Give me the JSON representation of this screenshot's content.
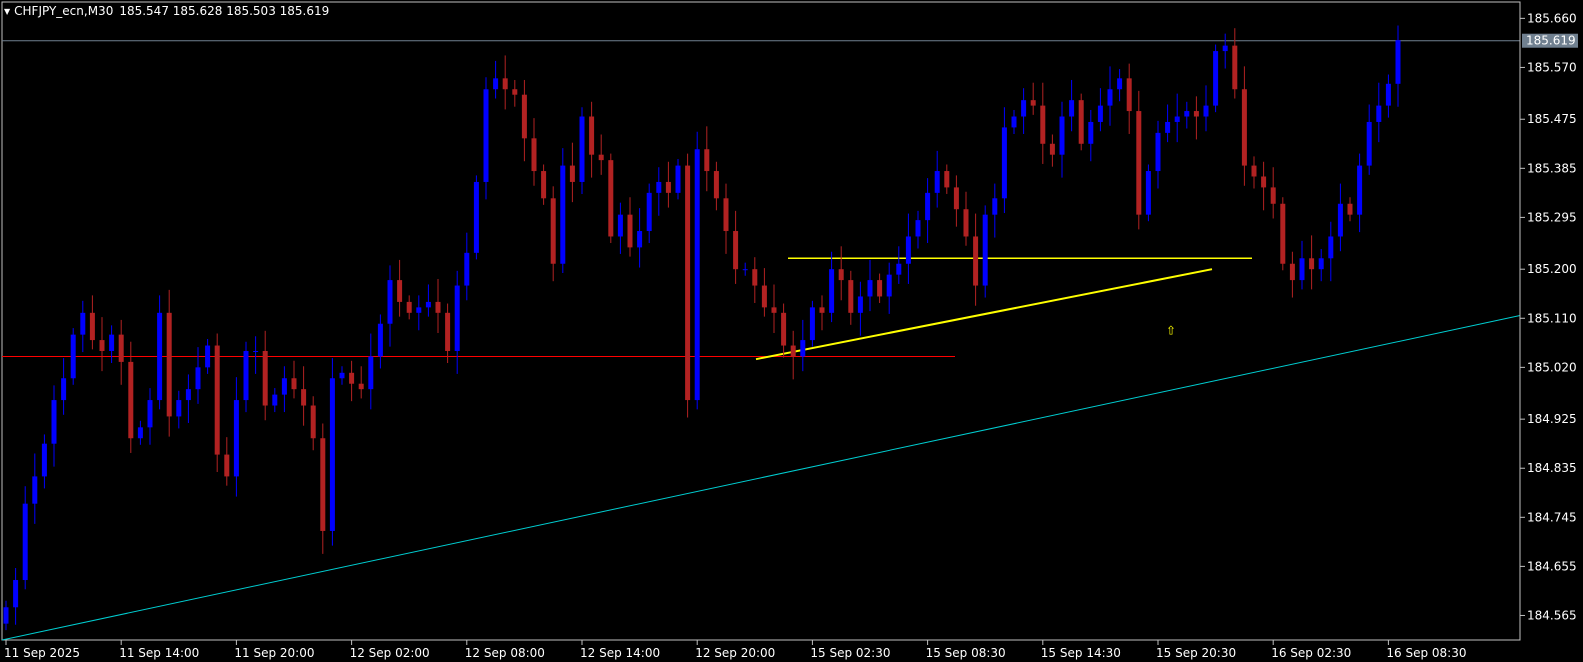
{
  "header": {
    "symbol": "CHFJPY_ecn,M30",
    "quotes": "185.547 185.628 185.503 185.619"
  },
  "colors": {
    "background": "#000000",
    "axis": "#c0c0c0",
    "bull": "#0000ff",
    "bear": "#b22222",
    "current_price_line": "#708090",
    "support_line": "#ff0000",
    "drawn_lines": "#ffff00",
    "trendline_long": "#00ced1",
    "arrow": "#ffff00"
  },
  "chart_data": {
    "type": "candlestick",
    "symbol": "CHFJPY_ecn",
    "timeframe": "M30",
    "ylim": [
      184.52,
      185.69
    ],
    "y_ticks": [
      "185.660",
      "185.570",
      "185.475",
      "185.385",
      "185.295",
      "185.200",
      "185.110",
      "185.020",
      "184.925",
      "184.835",
      "184.745",
      "184.655",
      "184.565"
    ],
    "x_ticks": [
      {
        "label": "11 Sep 2025",
        "bar": 0
      },
      {
        "label": "11 Sep 14:00",
        "bar": 12
      },
      {
        "label": "11 Sep 20:00",
        "bar": 24
      },
      {
        "label": "12 Sep 02:00",
        "bar": 36
      },
      {
        "label": "12 Sep 08:00",
        "bar": 48
      },
      {
        "label": "12 Sep 14:00",
        "bar": 60
      },
      {
        "label": "12 Sep 20:00",
        "bar": 72
      },
      {
        "label": "15 Sep 02:30",
        "bar": 84
      },
      {
        "label": "15 Sep 08:30",
        "bar": 96
      },
      {
        "label": "15 Sep 14:30",
        "bar": 108
      },
      {
        "label": "15 Sep 20:30",
        "bar": 120
      },
      {
        "label": "16 Sep 02:30",
        "bar": 132
      },
      {
        "label": "16 Sep 08:30",
        "bar": 144
      }
    ],
    "current_price": {
      "value": 185.619,
      "label": "185.619"
    },
    "closes": [
      184.58,
      184.63,
      184.77,
      184.82,
      184.88,
      184.96,
      185.0,
      185.08,
      185.12,
      185.07,
      185.05,
      185.08,
      185.03,
      184.89,
      184.91,
      184.96,
      185.12,
      184.93,
      184.96,
      184.98,
      185.02,
      185.06,
      184.86,
      184.82,
      184.96,
      185.05,
      185.05,
      184.95,
      184.97,
      185.0,
      184.98,
      184.95,
      184.89,
      184.72,
      185.0,
      185.01,
      184.99,
      184.98,
      185.04,
      185.1,
      185.18,
      185.14,
      185.12,
      185.13,
      185.14,
      185.12,
      185.05,
      185.17,
      185.23,
      185.36,
      185.53,
      185.55,
      185.53,
      185.52,
      185.44,
      185.38,
      185.33,
      185.21,
      185.39,
      185.36,
      185.48,
      185.41,
      185.4,
      185.26,
      185.3,
      185.24,
      185.27,
      185.34,
      185.36,
      185.34,
      185.39,
      184.96,
      185.42,
      185.38,
      185.33,
      185.27,
      185.2,
      185.2,
      185.17,
      185.13,
      185.12,
      185.06,
      185.04,
      185.07,
      185.13,
      185.12,
      185.2,
      185.18,
      185.12,
      185.15,
      185.18,
      185.15,
      185.19,
      185.21,
      185.26,
      185.29,
      185.34,
      185.38,
      185.35,
      185.31,
      185.26,
      185.17,
      185.3,
      185.33,
      185.46,
      185.48,
      185.51,
      185.5,
      185.43,
      185.41,
      185.48,
      185.51,
      185.43,
      185.47,
      185.5,
      185.53,
      185.55,
      185.49,
      185.3,
      185.38,
      185.45,
      185.47,
      185.48,
      185.49,
      185.48,
      185.5,
      185.6,
      185.61,
      185.53,
      185.39,
      185.37,
      185.35,
      185.32,
      185.21,
      185.18,
      185.22,
      185.2,
      185.22,
      185.26,
      185.32,
      185.3,
      185.39,
      185.47,
      185.5,
      185.54,
      185.62
    ]
  },
  "annotations": {
    "up_arrow": "⇧"
  }
}
